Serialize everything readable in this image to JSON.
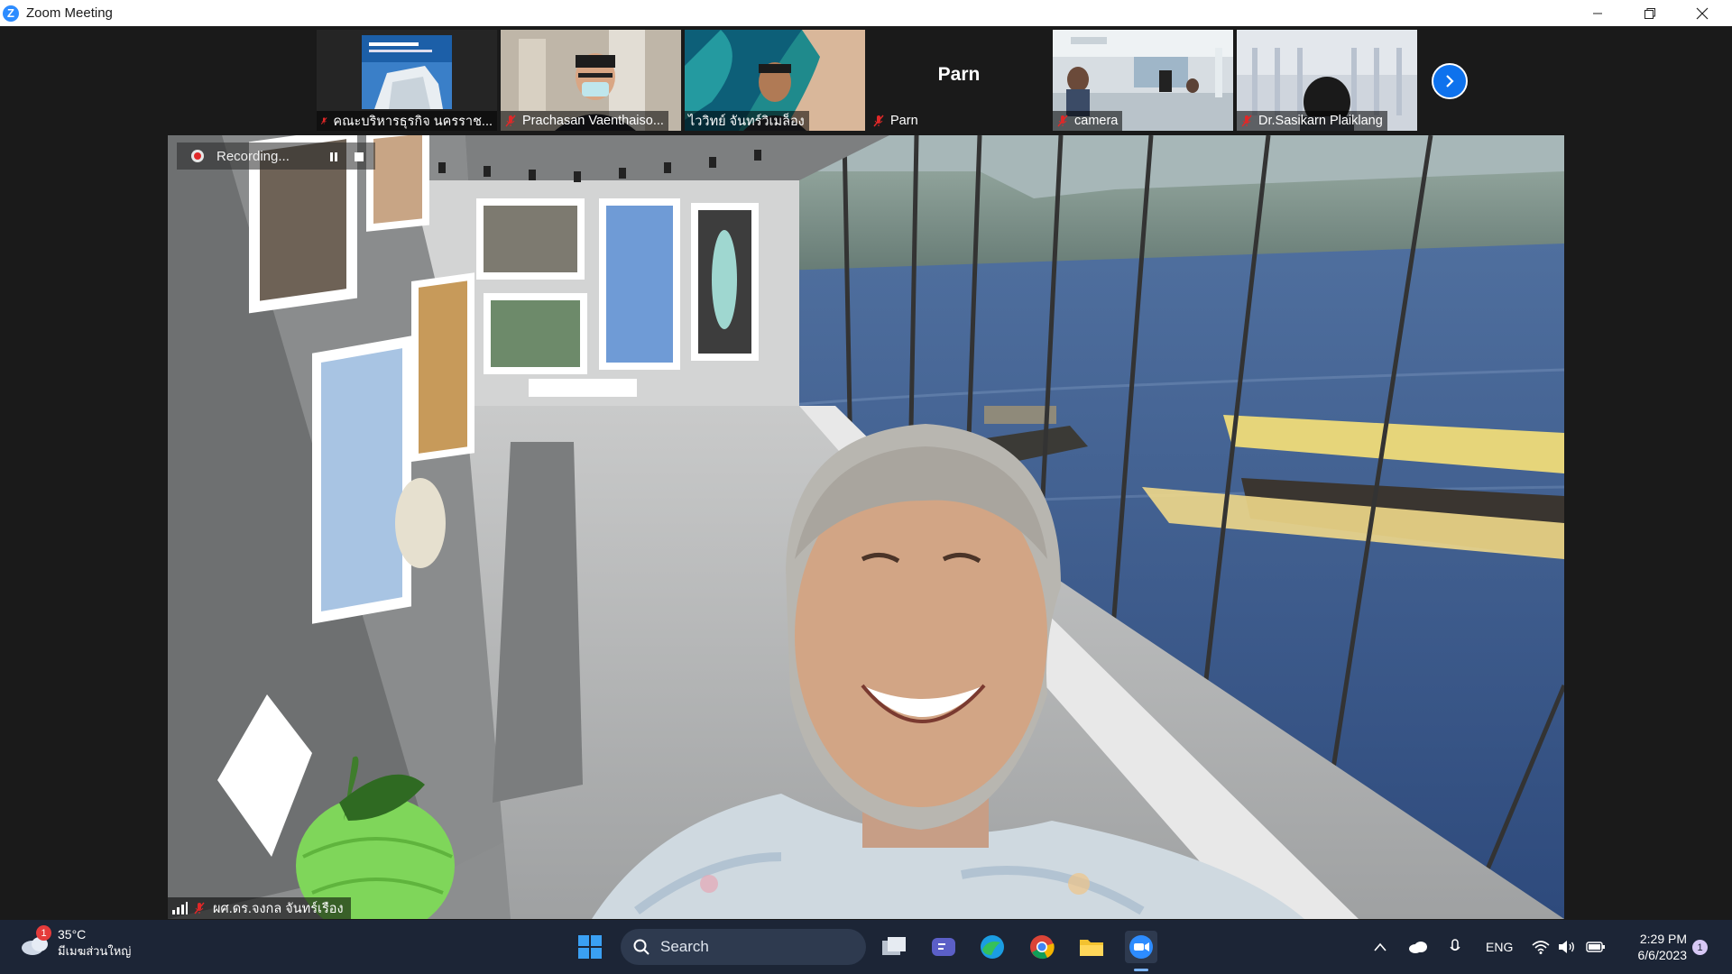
{
  "window": {
    "title": "Zoom Meeting",
    "app_icon_letter": "Z"
  },
  "gallery": {
    "tiles": [
      {
        "name": "คณะบริหารธุรกิจ นครราช...",
        "muted": true,
        "video": "logo"
      },
      {
        "name": "Prachasan Vaenthaiso...",
        "muted": true,
        "video": "camera"
      },
      {
        "name": "ไววิทย์ จันทร์วิเมล็อง",
        "muted": false,
        "video": "camera"
      },
      {
        "name": "Parn",
        "display_name": "Parn",
        "muted": true,
        "video": "off"
      },
      {
        "name": "camera",
        "muted": true,
        "video": "camera"
      },
      {
        "name": "Dr.Sasikarn Plaiklang",
        "muted": true,
        "video": "camera"
      }
    ],
    "next_button_icon": "chevron-right-icon"
  },
  "main_video": {
    "recording_label": "Recording...",
    "speaker_name": "ผศ.ดร.จงกล  จันทร์เรือง",
    "speaker_muted": true
  },
  "taskbar": {
    "weather": {
      "temp": "35°C",
      "desc": "มีเมฆส่วนใหญ่",
      "badge": "1"
    },
    "search_placeholder": "Search",
    "pinned": [
      "windows-icon",
      "task-view-icon",
      "teams-chat-icon",
      "edge-icon",
      "chrome-icon",
      "file-explorer-icon",
      "zoom-icon"
    ],
    "tray": {
      "language": "ENG"
    },
    "clock": {
      "time": "2:29 PM",
      "date": "6/6/2023"
    },
    "notification_badge": "1"
  },
  "colors": {
    "zoom_blue": "#2d8cff",
    "taskbar_bg": "#1c2536",
    "mute_red": "#e02828"
  }
}
